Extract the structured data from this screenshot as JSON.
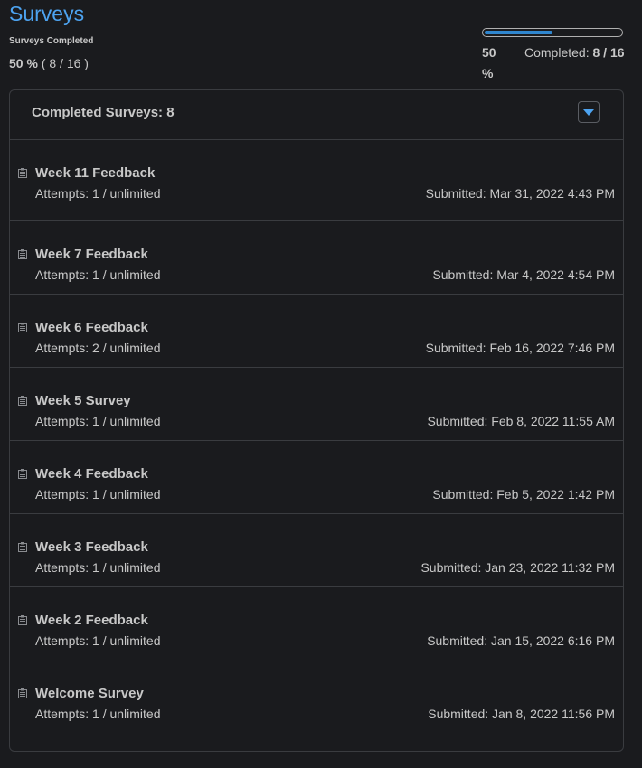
{
  "page": {
    "title": "Surveys"
  },
  "summary": {
    "label": "Surveys Completed",
    "percent_text": "50 %",
    "count_text": "( 8 / 16 )"
  },
  "progress": {
    "fraction": 0.5,
    "percent_text": "50 %",
    "completed_label": "Completed:",
    "completed_value": "8 / 16"
  },
  "panel": {
    "title": "Completed Surveys: 8",
    "collapse_icon": "caret-down-icon"
  },
  "surveys": [
    {
      "name": "Week 11 Feedback",
      "attempts": "Attempts: 1 / unlimited",
      "submitted": "Submitted: Mar 31, 2022 4:43 PM"
    },
    {
      "name": "Week 7 Feedback",
      "attempts": "Attempts: 1 / unlimited",
      "submitted": "Submitted: Mar 4, 2022 4:54 PM"
    },
    {
      "name": "Week 6 Feedback",
      "attempts": "Attempts: 2 / unlimited",
      "submitted": "Submitted: Feb 16, 2022 7:46 PM"
    },
    {
      "name": "Week 5 Survey",
      "attempts": "Attempts: 1 / unlimited",
      "submitted": "Submitted: Feb 8, 2022 11:55 AM"
    },
    {
      "name": "Week 4 Feedback",
      "attempts": "Attempts: 1 / unlimited",
      "submitted": "Submitted: Feb 5, 2022 1:42 PM"
    },
    {
      "name": "Week 3 Feedback",
      "attempts": "Attempts: 1 / unlimited",
      "submitted": "Submitted: Jan 23, 2022 11:32 PM"
    },
    {
      "name": "Week 2 Feedback",
      "attempts": "Attempts: 1 / unlimited",
      "submitted": "Submitted: Jan 15, 2022 6:16 PM"
    },
    {
      "name": "Welcome Survey",
      "attempts": "Attempts: 1 / unlimited",
      "submitted": "Submitted: Jan 8, 2022 11:56 PM"
    }
  ],
  "icons": {
    "survey": "clipboard-icon"
  },
  "colors": {
    "accent": "#4da3f0",
    "progress_fill": "#2f86cf",
    "background": "#1a1b1e"
  }
}
